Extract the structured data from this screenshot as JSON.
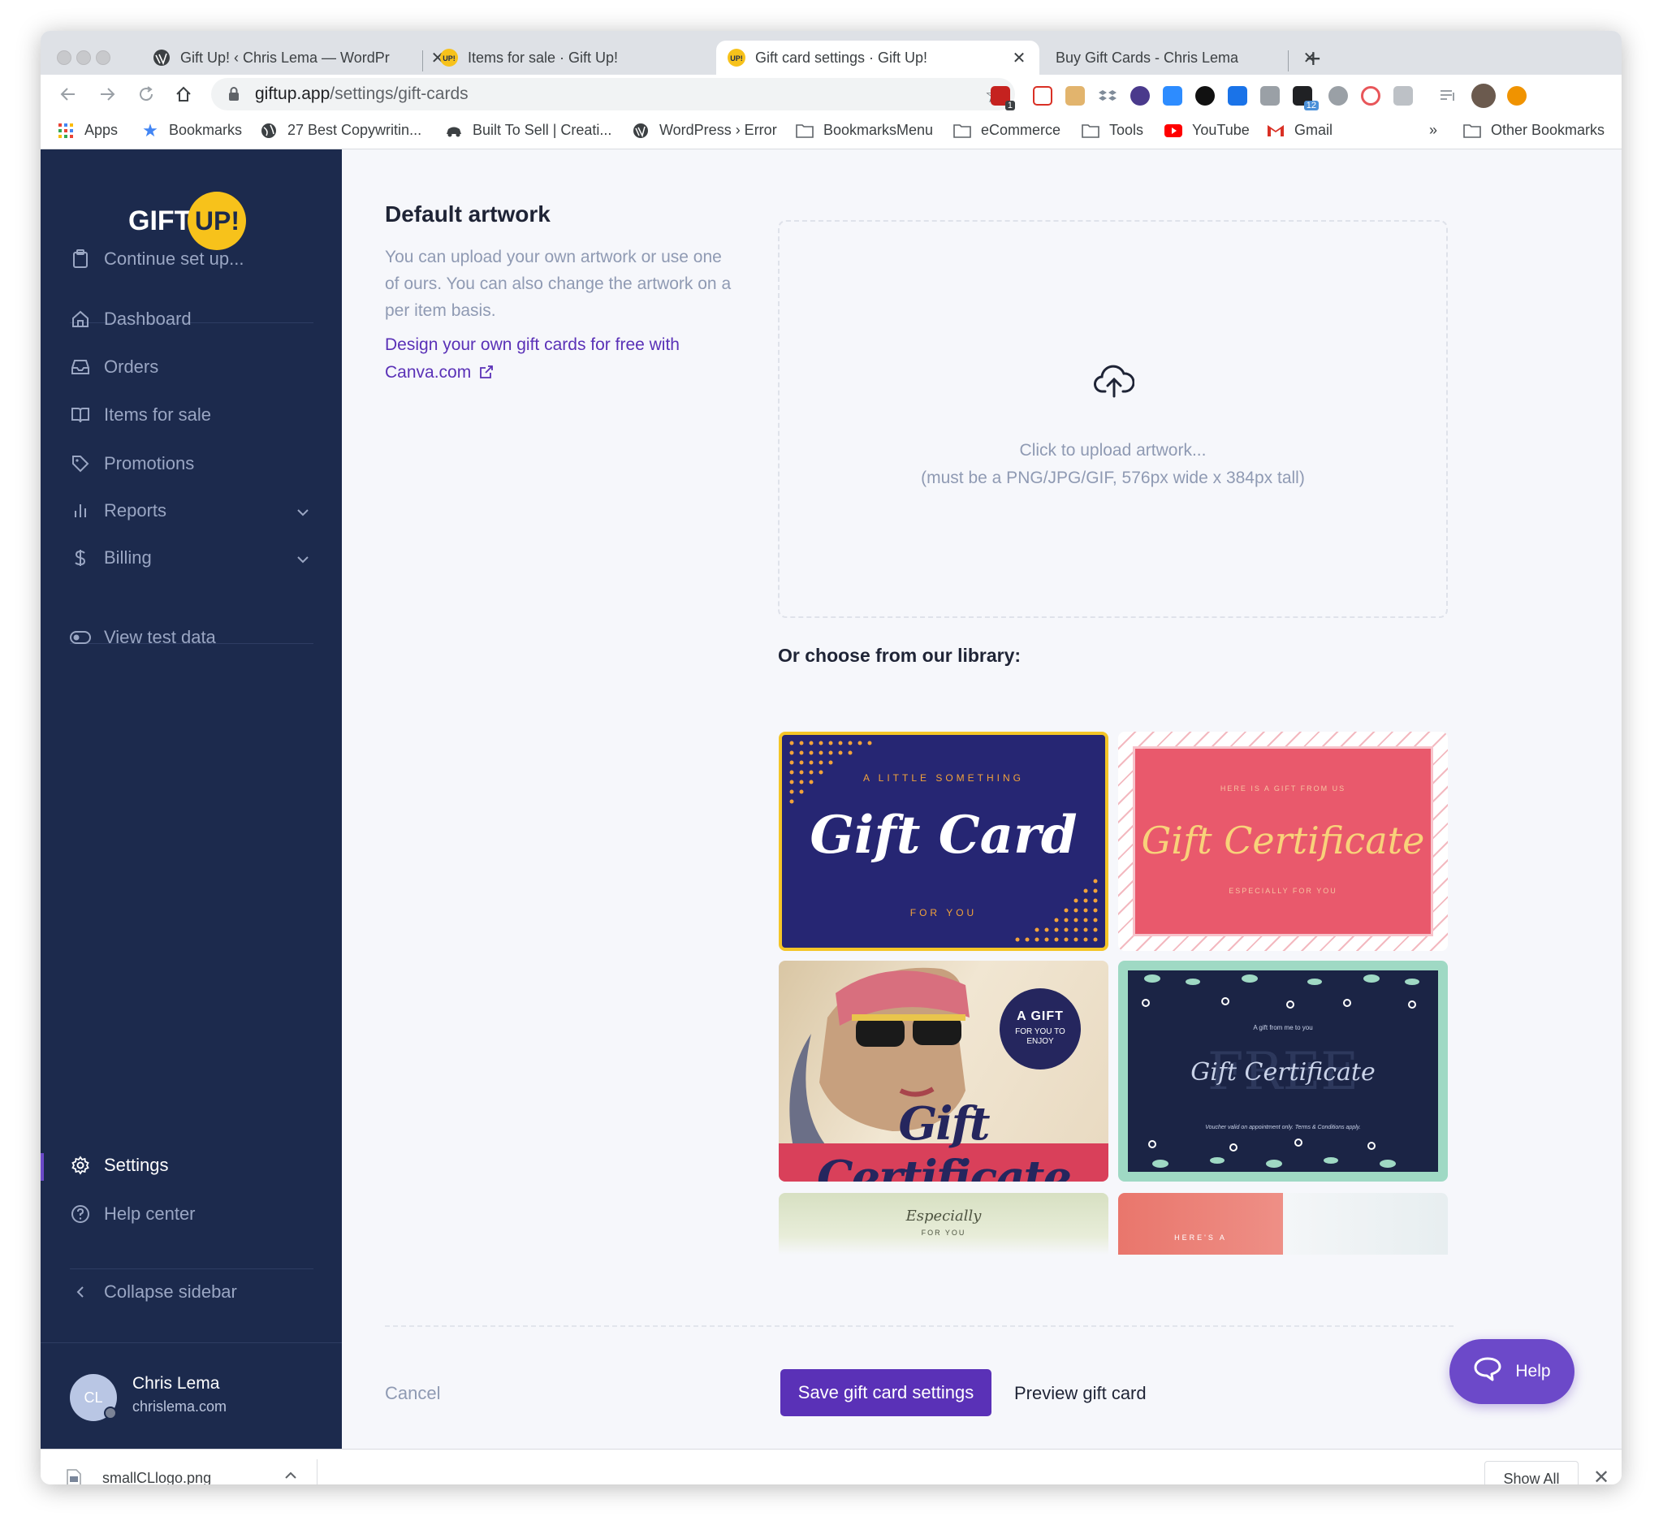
{
  "browser": {
    "tabs": [
      {
        "title": "Gift Up! ‹ Chris Lema — WordPr",
        "active": false
      },
      {
        "title": "Items for sale · Gift Up!",
        "active": false
      },
      {
        "title": "Gift card settings · Gift Up!",
        "active": true
      },
      {
        "title": "Buy Gift Cards - Chris Lema",
        "active": false
      }
    ],
    "address": {
      "host": "giftup.app",
      "path": "/settings/gift-cards"
    },
    "extension_badges": {
      "todoist": "1",
      "stats": "12"
    },
    "bookmarks": [
      "Apps",
      "Bookmarks",
      "27 Best Copywritin...",
      "Built To Sell | Creati...",
      "WordPress › Error",
      "BookmarksMenu",
      "eCommerce",
      "Tools",
      "YouTube",
      "Gmail"
    ],
    "bookmarks_overflow": "»",
    "other_bookmarks": "Other Bookmarks"
  },
  "sidebar": {
    "logo": {
      "left": "GIFT",
      "right": "UP!"
    },
    "setup": "Continue set up...",
    "items": [
      {
        "label": "Dashboard",
        "icon": "home-icon"
      },
      {
        "label": "Orders",
        "icon": "inbox-icon"
      },
      {
        "label": "Items for sale",
        "icon": "book-icon"
      },
      {
        "label": "Promotions",
        "icon": "tag-icon"
      },
      {
        "label": "Reports",
        "icon": "bar-chart-icon"
      },
      {
        "label": "Billing",
        "icon": "dollar-icon"
      }
    ],
    "test_data": "View test data",
    "settings": "Settings",
    "help_center": "Help center",
    "collapse": "Collapse sidebar",
    "user": {
      "initials": "CL",
      "name": "Chris Lema",
      "site": "chrislema.com"
    }
  },
  "main": {
    "heading": "Default artwork",
    "description": "You can upload your own artwork or use one of ours. You can also change the artwork on a per item basis.",
    "canva_link": "Design your own gift cards for free with Canva.com",
    "upload": {
      "line1": "Click to upload artwork...",
      "line2": "(must be a PNG/JPG/GIF, 576px wide x 384px tall)"
    },
    "library_heading": "Or choose from our library:",
    "cards": {
      "card1": {
        "top": "A LITTLE SOMETHING",
        "title": "Gift Card",
        "bottom": "FOR YOU"
      },
      "card2": {
        "top": "HERE IS A GIFT FROM US",
        "title": "Gift Certificate",
        "bottom": "ESPECIALLY FOR YOU"
      },
      "card3": {
        "badge1": "A GIFT",
        "badge2": "FOR YOU TO",
        "badge3": "ENJOY",
        "title": "Gift Certificate"
      },
      "card4": {
        "top": "A gift from me to you",
        "watermark": "FREE",
        "title": "Gift Certificate",
        "bottom": "Voucher valid on appointment only. Terms & Conditions apply."
      },
      "card5": {
        "title": "Especially",
        "sub": "FOR YOU"
      },
      "card6": {
        "text": "HERE'S A"
      }
    },
    "cancel": "Cancel",
    "save": "Save gift card settings",
    "preview": "Preview gift card",
    "help": "Help"
  },
  "downloads": {
    "file": "smallCLlogo.png",
    "show_all": "Show All"
  },
  "colors": {
    "sidebar": "#1c2a4d",
    "accent": "#5a31b7",
    "logo_yellow": "#f7c21b",
    "selected_border": "#f4c527"
  }
}
